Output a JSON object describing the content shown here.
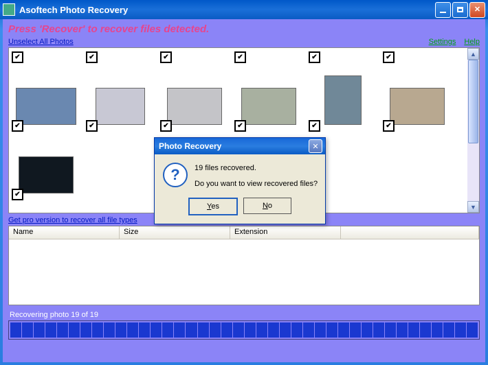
{
  "window": {
    "title": "Asoftech Photo Recovery"
  },
  "instruction": "Press 'Recover' to recover files detected.",
  "links": {
    "unselect": "Unselect All Photos",
    "settings": "Settings",
    "help": "Help",
    "pro": "Get pro version to recover all file types"
  },
  "photos": [
    {
      "w": 4,
      "h": 0,
      "bg": "#ffffff"
    },
    {
      "w": 4,
      "h": 0,
      "bg": "#ffffff"
    },
    {
      "w": 4,
      "h": 0,
      "bg": "#ffffff"
    },
    {
      "w": 4,
      "h": 0,
      "bg": "#ffffff"
    },
    {
      "w": 4,
      "h": 0,
      "bg": "#ffffff"
    },
    {
      "w": 4,
      "h": 0,
      "bg": "#ffffff"
    },
    {
      "w": 86,
      "h": 52,
      "bg": "#6a88b0"
    },
    {
      "w": 70,
      "h": 52,
      "bg": "#c8c8d4"
    },
    {
      "w": 78,
      "h": 52,
      "bg": "#c4c4c8"
    },
    {
      "w": 78,
      "h": 52,
      "bg": "#a8b0a0"
    },
    {
      "w": 52,
      "h": 70,
      "bg": "#708898"
    },
    {
      "w": 78,
      "h": 52,
      "bg": "#b8a890"
    },
    {
      "w": 78,
      "h": 52,
      "bg": "#101820"
    }
  ],
  "table": {
    "headers": [
      "Name",
      "Size",
      "Extension"
    ]
  },
  "status": "Recovering photo 19 of 19",
  "progress_segments": 40,
  "dialog": {
    "title": "Photo Recovery",
    "line1": "19 files recovered.",
    "line2": "Do you want to view recovered files?",
    "yes": "Yes",
    "no": "No"
  }
}
